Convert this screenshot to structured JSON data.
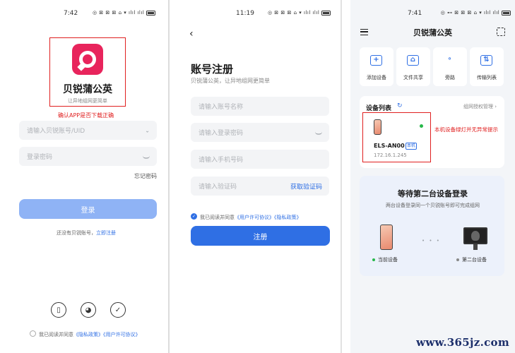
{
  "screen1": {
    "status_time": "7:42",
    "status_icons": "◎ ⊠ ⊠ ⊠ ⌂ ▾ ılıl ılıl",
    "app_name": "贝锐蒲公英",
    "app_slogan": "让异地组网更简单",
    "annotation": "确认APP是否下载正确",
    "account_placeholder": "请输入贝锐账号/UID",
    "password_placeholder": "登录密码",
    "forgot_password": "忘记密码",
    "login_button": "登录",
    "no_account": "还没有贝锐账号，",
    "register_now": "立即注册",
    "agreement_prefix": "我已阅读并同意",
    "privacy_policy": "《隐私政策》",
    "user_agreement": "《用户许可协议》",
    "social_icons": [
      "phone-icon",
      "wechat-icon",
      "shield-icon"
    ]
  },
  "screen2": {
    "status_time": "11:19",
    "status_icons": "◎ ⊠ ⊠ ⊠ ⌂ ▾ ılıl ılıl",
    "back": "‹",
    "title": "账号注册",
    "subtitle": "贝锐蒲公英，让异地组网更简单",
    "account_placeholder": "请输入账号名称",
    "password_placeholder": "请输入登录密码",
    "phone_placeholder": "请输入手机号码",
    "code_placeholder": "请输入验证码",
    "get_code": "获取验证码",
    "agreement_prefix": "我已阅读并同意",
    "user_agreement": "《用户许可协议》",
    "privacy_policy": "《隐私政策》",
    "register_button": "注册"
  },
  "screen3": {
    "status_time": "7:41",
    "status_icons": "◎ ⊷ ⊠ ⊠ ⊠ ⌂ ▾ ılıl ılıl",
    "title": "贝锐蒲公英",
    "tiles": [
      {
        "label": "添加设备",
        "icon": "add-icon",
        "glyph": "+"
      },
      {
        "label": "文件共享",
        "icon": "folder-icon",
        "glyph": "⌂"
      },
      {
        "label": "旁路",
        "icon": "bypass-icon",
        "glyph": "∘"
      },
      {
        "label": "传输列表",
        "icon": "transfer-icon",
        "glyph": "⇅"
      }
    ],
    "device_list_title": "设备列表",
    "refresh_glyph": "↻",
    "group_auth": "组网授权管理 ›",
    "device": {
      "name": "ELS-AN00",
      "tag": "本机",
      "ip": "172.16.1.245"
    },
    "annotation": "本机设备绿灯并无异常提示",
    "waiting_title": "等待第二台设备登录",
    "waiting_sub": "两台设备登录同一个贝锐账号即可完成组网",
    "current_device": "当前设备",
    "second_device": "第二台设备"
  },
  "watermark": "www.365jz.com",
  "colors": {
    "accent": "#2f6fe4",
    "accent_disabled": "#8fb3f5",
    "brand": "#e8245c",
    "annotation": "#e02020",
    "online": "#27b84a"
  }
}
